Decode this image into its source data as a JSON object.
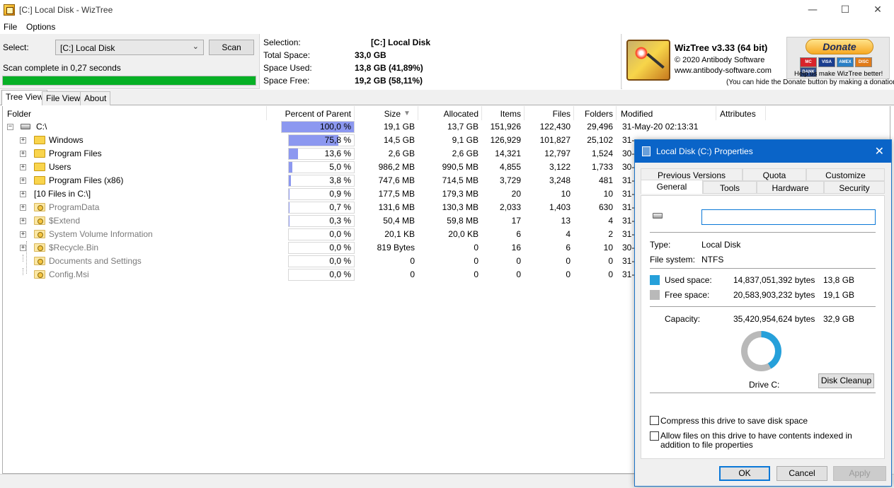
{
  "window": {
    "title": "[C:] Local Disk  - WizTree",
    "minimize_glyph": "—",
    "maximize_glyph": "☐",
    "close_glyph": "✕"
  },
  "menu": {
    "file": "File",
    "options": "Options"
  },
  "toolbar": {
    "select_label": "Select:",
    "drive_value": "[C:] Local Disk",
    "scan_label": "Scan",
    "status": "Scan complete in 0,27 seconds",
    "progress": 1.0,
    "progress_color": "#06b025"
  },
  "selection": {
    "labels": [
      "Selection:",
      "Total Space:",
      "Space Used:",
      "Space Free:"
    ],
    "values": [
      "[C:]  Local Disk",
      "33,0 GB",
      "13,8 GB  (41,89%)",
      "19,2 GB  (58,11%)"
    ]
  },
  "brand": {
    "name": "WizTree v3.33 (64 bit)",
    "copyright": "© 2020 Antibody Software",
    "url": "www.antibody-software.com",
    "donate_label": "Donate",
    "cards": [
      "MC",
      "VISA",
      "AMEX",
      "DISC",
      "BANK"
    ],
    "donate_text": "Help us make WizTree better!",
    "hide_note": "(You can hide the Donate button by making a donation)"
  },
  "tabs": [
    "Tree View",
    "File View",
    "About"
  ],
  "columns": {
    "folder": "Folder",
    "percent": "Percent of Parent",
    "size": "Size",
    "sort_glyph": "▼",
    "allocated": "Allocated",
    "items": "Items",
    "files": "Files",
    "folders": "Folders",
    "modified": "Modified",
    "attributes": "Attributes"
  },
  "rows": [
    {
      "name": "C:\\",
      "pct": "100,0 %",
      "pct_value": 1.0,
      "size": "19,1 GB",
      "allocated": "13,7 GB",
      "items": "151,926",
      "files": "122,430",
      "folders": "29,496",
      "modified": "31-May-20 02:13:31",
      "level": 0,
      "icon": "drive",
      "expander": "-",
      "grey": false
    },
    {
      "name": "Windows",
      "pct": "75,8 %",
      "pct_value": 0.758,
      "size": "14,5 GB",
      "allocated": "9,1 GB",
      "items": "126,929",
      "files": "101,827",
      "folders": "25,102",
      "modified": "31-",
      "level": 1,
      "icon": "folder",
      "expander": "+",
      "grey": false
    },
    {
      "name": "Program Files",
      "pct": "13,6 %",
      "pct_value": 0.136,
      "size": "2,6 GB",
      "allocated": "2,6 GB",
      "items": "14,321",
      "files": "12,797",
      "folders": "1,524",
      "modified": "30-",
      "level": 1,
      "icon": "folder",
      "expander": "+",
      "grey": false
    },
    {
      "name": "Users",
      "pct": "5,0 %",
      "pct_value": 0.05,
      "size": "986,2 MB",
      "allocated": "990,5 MB",
      "items": "4,855",
      "files": "3,122",
      "folders": "1,733",
      "modified": "30-",
      "level": 1,
      "icon": "folder",
      "expander": "+",
      "grey": false
    },
    {
      "name": "Program Files (x86)",
      "pct": "3,8 %",
      "pct_value": 0.038,
      "size": "747,6 MB",
      "allocated": "714,5 MB",
      "items": "3,729",
      "files": "3,248",
      "folders": "481",
      "modified": "31-",
      "level": 1,
      "icon": "folder",
      "expander": "+",
      "grey": false
    },
    {
      "name": "[10 Files in C:\\]",
      "pct": "0,9 %",
      "pct_value": 0.009,
      "size": "177,5 MB",
      "allocated": "179,3 MB",
      "items": "20",
      "files": "10",
      "folders": "10",
      "modified": "31-",
      "level": 1,
      "icon": "none",
      "expander": "+",
      "grey": false
    },
    {
      "name": "ProgramData",
      "pct": "0,7 %",
      "pct_value": 0.007,
      "size": "131,6 MB",
      "allocated": "130,3 MB",
      "items": "2,033",
      "files": "1,403",
      "folders": "630",
      "modified": "31-",
      "level": 1,
      "icon": "folder-sys",
      "expander": "+",
      "grey": true
    },
    {
      "name": "$Extend",
      "pct": "0,3 %",
      "pct_value": 0.003,
      "size": "50,4 MB",
      "allocated": "59,8 MB",
      "items": "17",
      "files": "13",
      "folders": "4",
      "modified": "31-",
      "level": 1,
      "icon": "folder-sys",
      "expander": "+",
      "grey": true
    },
    {
      "name": "System Volume Information",
      "pct": "0,0 %",
      "pct_value": 0.0,
      "size": "20,1 KB",
      "allocated": "20,0 KB",
      "items": "6",
      "files": "4",
      "folders": "2",
      "modified": "31-",
      "level": 1,
      "icon": "folder-sys",
      "expander": "+",
      "grey": true
    },
    {
      "name": "$Recycle.Bin",
      "pct": "0,0 %",
      "pct_value": 0.0,
      "size": "819 Bytes",
      "allocated": "0",
      "items": "16",
      "files": "6",
      "folders": "10",
      "modified": "30-",
      "level": 1,
      "icon": "folder-sys",
      "expander": "+",
      "grey": true
    },
    {
      "name": "Documents and Settings",
      "pct": "0,0 %",
      "pct_value": 0.0,
      "size": "0",
      "allocated": "0",
      "items": "0",
      "files": "0",
      "folders": "0",
      "modified": "31-",
      "level": 1,
      "icon": "folder-sys",
      "expander": "",
      "grey": true
    },
    {
      "name": "Config.Msi",
      "pct": "0,0 %",
      "pct_value": 0.0,
      "size": "0",
      "allocated": "0",
      "items": "0",
      "files": "0",
      "folders": "0",
      "modified": "31-",
      "level": 1,
      "icon": "folder-sys",
      "expander": "",
      "grey": true
    }
  ],
  "dialog": {
    "title": "Local Disk (C:) Properties",
    "close_glyph": "✕",
    "tabs_top": [
      "Previous Versions",
      "Quota",
      "Customize"
    ],
    "tabs_bottom": [
      "General",
      "Tools",
      "Hardware",
      "Security"
    ],
    "volume_name": "",
    "type_label": "Type:",
    "type_value": "Local Disk",
    "fs_label": "File system:",
    "fs_value": "NTFS",
    "used_label": "Used space:",
    "used_bytes": "14,837,051,392 bytes",
    "used_gb": "13,8 GB",
    "used_color": "#26a0da",
    "free_label": "Free space:",
    "free_bytes": "20,583,903,232 bytes",
    "free_gb": "19,1 GB",
    "free_color": "#b9b9b9",
    "capacity_label": "Capacity:",
    "capacity_bytes": "35,420,954,624 bytes",
    "capacity_gb": "32,9 GB",
    "drive_label": "Drive C:",
    "cleanup_label": "Disk Cleanup",
    "compress_label": "Compress this drive to save disk space",
    "index_label": "Allow files on this drive to have contents indexed in addition to file properties",
    "ok_label": "OK",
    "cancel_label": "Cancel",
    "apply_label": "Apply"
  }
}
